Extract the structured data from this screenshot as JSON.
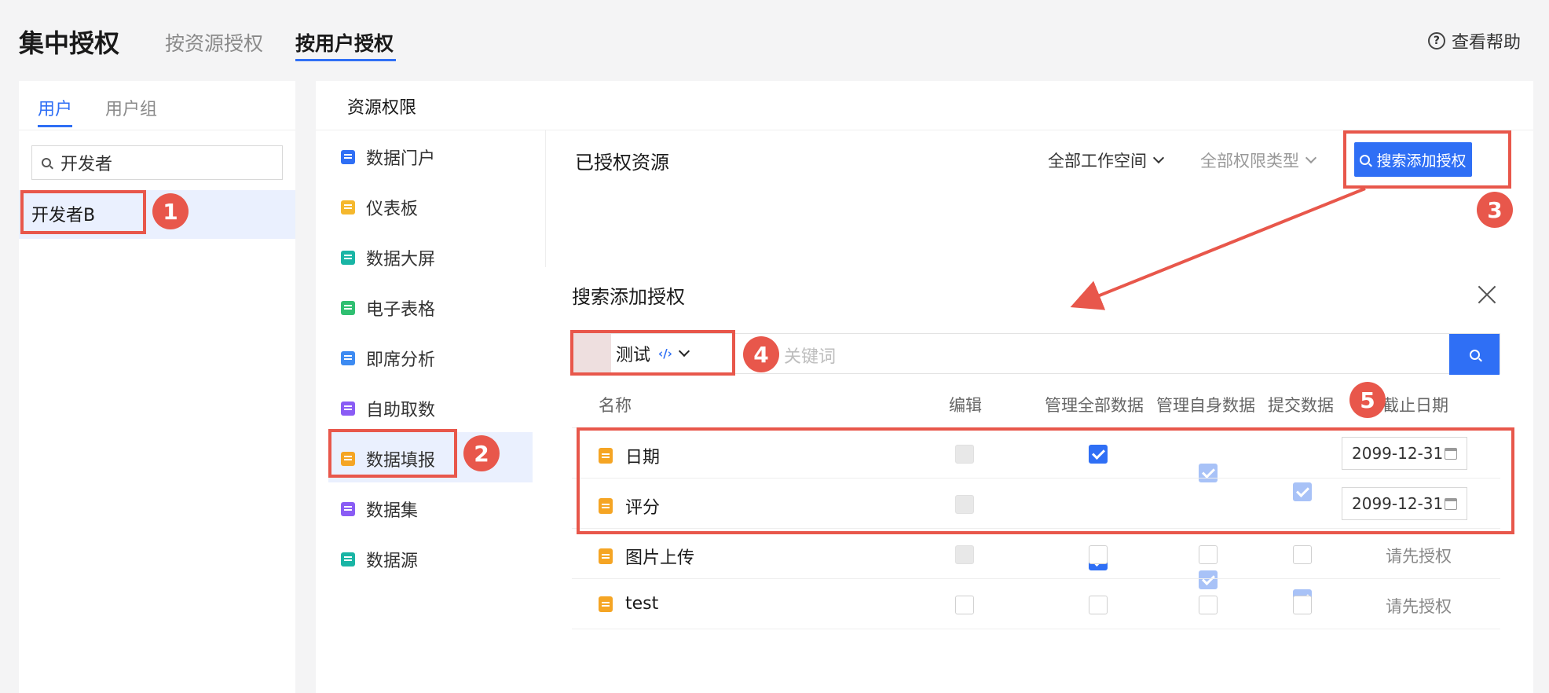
{
  "header": {
    "title": "集中授权",
    "tabs": [
      {
        "label": "按资源授权",
        "active": false
      },
      {
        "label": "按用户授权",
        "active": true
      }
    ],
    "help_label": "查看帮助"
  },
  "left_panel": {
    "tabs": [
      {
        "label": "用户",
        "active": true
      },
      {
        "label": "用户组",
        "active": false
      }
    ],
    "search_value": "开发者",
    "users": [
      {
        "name": "开发者B",
        "selected": true
      }
    ]
  },
  "right_panel": {
    "heading": "资源权限",
    "resource_types": [
      {
        "label": "数据门户",
        "icon": "portal-icon",
        "color": "#2f6ff5"
      },
      {
        "label": "仪表板",
        "icon": "dashboard-icon",
        "color": "#f5b82e"
      },
      {
        "label": "数据大屏",
        "icon": "screen-icon",
        "color": "#19b5a5"
      },
      {
        "label": "电子表格",
        "icon": "spreadsheet-icon",
        "color": "#2fbf71"
      },
      {
        "label": "即席分析",
        "icon": "adhoc-analysis-icon",
        "color": "#3d8bf2"
      },
      {
        "label": "自助取数",
        "icon": "self-service-icon",
        "color": "#8a5cf5"
      },
      {
        "label": "数据填报",
        "icon": "data-form-icon",
        "color": "#f5a524",
        "active": true
      },
      {
        "label": "数据集",
        "icon": "dataset-icon",
        "color": "#8a5cf5"
      },
      {
        "label": "数据源",
        "icon": "datasource-icon",
        "color": "#19b5a5"
      }
    ],
    "authorized_title": "已授权资源",
    "filters": [
      {
        "label": "全部工作空间"
      },
      {
        "label": "全部权限类型"
      }
    ],
    "search_add_button": "搜索添加授权"
  },
  "modal": {
    "title": "搜索添加授权",
    "workspace_select": "测试",
    "keyword_placeholder": "关键词",
    "columns": [
      "名称",
      "编辑",
      "管理全部数据",
      "管理自身数据",
      "提交数据",
      "截止日期"
    ],
    "rows": [
      {
        "name": "日期",
        "edit": "disabled",
        "manage_all": "checked",
        "manage_own": "checked-dim",
        "submit": "checked-dim",
        "deadline": "2099-12-31"
      },
      {
        "name": "评分",
        "edit": "disabled",
        "manage_all": "checked",
        "manage_own": "checked-dim",
        "submit": "checked-dim",
        "deadline": "2099-12-31"
      },
      {
        "name": "图片上传",
        "edit": "disabled",
        "manage_all": "empty",
        "manage_own": "empty",
        "submit": "empty",
        "deadline_text": "请先授权"
      },
      {
        "name": "test",
        "edit": "empty",
        "manage_all": "empty",
        "manage_own": "empty",
        "submit": "empty",
        "deadline_text": "请先授权"
      }
    ]
  },
  "annotations": {
    "badges": [
      "1",
      "2",
      "3",
      "4",
      "5"
    ],
    "color": "#e8574b"
  }
}
